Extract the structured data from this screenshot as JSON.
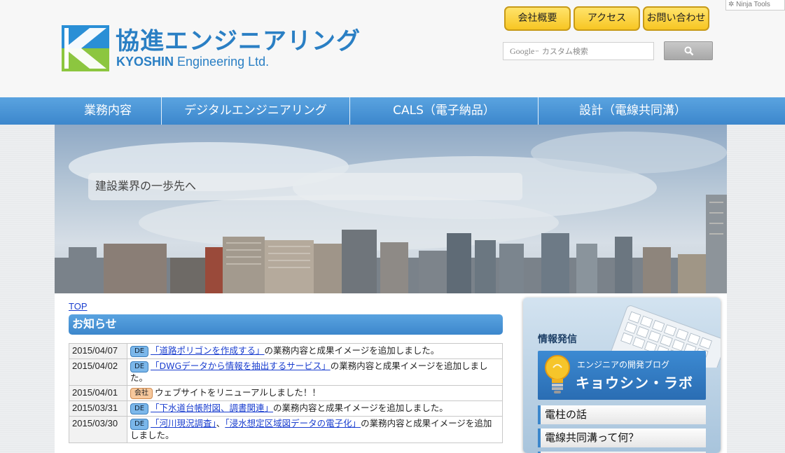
{
  "header": {
    "logo_jp": "協進エンジニアリング",
    "logo_en_bold": "KYOSHIN",
    "logo_en_rest": " Engineering Ltd.",
    "buttons": [
      "会社概要",
      "アクセス",
      "お問い合わせ"
    ],
    "search_google": "Google",
    "search_placeholder": "カスタム検索",
    "ninja_label": "Ninja Tools"
  },
  "nav": {
    "items": [
      "業務内容",
      "デジタルエンジニアリング",
      "CALS（電子納品）",
      "設計（電線共同溝）"
    ]
  },
  "hero": {
    "tagline": "建設業界の一歩先へ"
  },
  "main": {
    "breadcrumb": "TOP",
    "news_title": "お知らせ",
    "news": [
      {
        "date": "2015/04/07",
        "tag": "DE",
        "links": [
          "「道路ポリゴンを作成する」"
        ],
        "text": "の業務内容と成果イメージを追加しました。"
      },
      {
        "date": "2015/04/02",
        "tag": "DE",
        "links": [
          "「DWGデータから情報を抽出するサービス」"
        ],
        "text": "の業務内容と成果イメージを追加しました。"
      },
      {
        "date": "2015/04/01",
        "tag": "会社",
        "links": [],
        "text": "ウェブサイトをリニューアルしました！！"
      },
      {
        "date": "2015/03/31",
        "tag": "DE",
        "links": [
          "「下水道台帳附図、調書関連」"
        ],
        "text": "の業務内容と成果イメージを追加しました。"
      },
      {
        "date": "2015/03/30",
        "tag": "DE",
        "links": [
          "「河川現況調査」",
          "「浸水想定区域図データの電子化」"
        ],
        "sep": "、",
        "text": "の業務内容と成果イメージを追加しました。"
      }
    ]
  },
  "sidebar": {
    "heading": "情報発信",
    "blog_sub": "エンジニアの開発ブログ",
    "blog_main": "キョウシン・ラボ",
    "links": [
      "電柱の話",
      "電線共同溝って何？"
    ]
  },
  "colors": {
    "brand_blue": "#2a7fc4",
    "nav_blue": "#3c87cc",
    "button_yellow": "#f7c623",
    "logo_green": "#8cc63f"
  }
}
